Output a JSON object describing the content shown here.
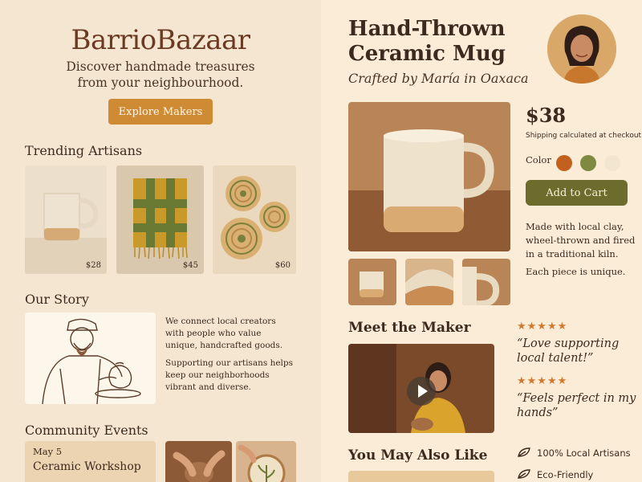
{
  "marketplace": {
    "brand": "BarrioBazaar",
    "tagline_line1": "Discover handmade treasures",
    "tagline_line2": "from your neighbourhood.",
    "cta_label": "Explore Makers",
    "trending_title": "Trending Artisans",
    "trending_items": [
      {
        "price": "$28",
        "icon": "mug-image"
      },
      {
        "price": "$45",
        "icon": "woven-textile-image"
      },
      {
        "price": "$60",
        "icon": "woven-baskets-image"
      }
    ],
    "story_title": "Our Story",
    "story_p1": "We connect local creators with people who value unique, handcrafted goods.",
    "story_p2": "Supporting our artisans helps keep our neighborhoods vibrant and diverse.",
    "events_title": "Community Events",
    "event": {
      "date": "May 5",
      "name": "Ceramic Workshop"
    }
  },
  "product": {
    "title": "Hand-Thrown Ceramic Mug",
    "subtitle": "Crafted by María in Oaxaca",
    "price": "$38",
    "shipping_note": "Shipping calculated at checkout",
    "color_label": "Color",
    "colors": [
      "#c2611f",
      "#7d8a3f",
      "#f2e6cf"
    ],
    "add_to_cart_label": "Add to Cart",
    "description": "Made with local clay, wheel-thrown and fired in a traditional kiln.",
    "description2": "Each piece is unique.",
    "meet_maker_title": "Meet the Maker",
    "reviews": [
      {
        "stars": "★★★★★",
        "text": "“Love supporting local talent!”"
      },
      {
        "stars": "★★★★★",
        "text": "“Feels perfect in my hands”"
      }
    ],
    "also_like_title": "You May Also Like",
    "features": [
      {
        "label": "100% Local Artisans",
        "icon": "leaf-icon"
      },
      {
        "label": "Eco-Friendly Packaging",
        "icon": "leaf-icon"
      }
    ]
  },
  "colors": {
    "accent_orange": "#cf8a34",
    "accent_olive": "#6d6c2c",
    "brand_brown": "#6b3a22",
    "star": "#d0792f"
  }
}
